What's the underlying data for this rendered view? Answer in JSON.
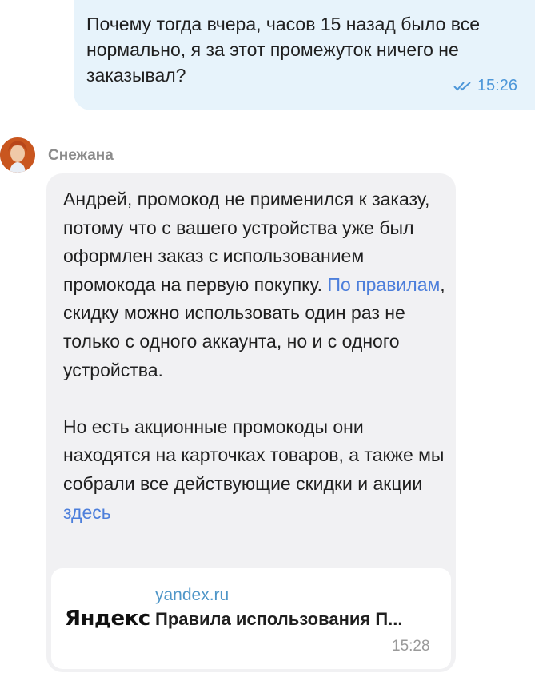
{
  "outgoing": {
    "text": "Почему тогда вчера, часов 15 назад было все нормально, я за этот промежуток ничего не заказывал?",
    "time": "15:26",
    "status_icon": "double-check-icon"
  },
  "incoming": {
    "sender": "Снежана",
    "avatar_icon": "user-avatar",
    "p1_before_link": "Андрей, промокод не применился к заказу, потому что с вашего устройства уже был оформлен заказ с использованием промокода на первую покупку. ",
    "p1_link": "По правилам",
    "p1_after_link": ", скидку можно использовать один раз не только с одного аккаунта, но и с одного устройства.",
    "p2_before_link": "Но есть акционные промокоды они находятся на карточках товаров, а также мы собрали все действующие скидки и акции ",
    "p2_link": "здесь",
    "preview": {
      "logo": "Яндекс",
      "domain": "yandex.ru",
      "title": "Правила использования П..."
    },
    "time": "15:28"
  },
  "colors": {
    "outgoing_bubble": "#e7f3fb",
    "incoming_bubble": "#f1f1f3",
    "link": "#4d7fdb",
    "check": "#4d97d9"
  }
}
